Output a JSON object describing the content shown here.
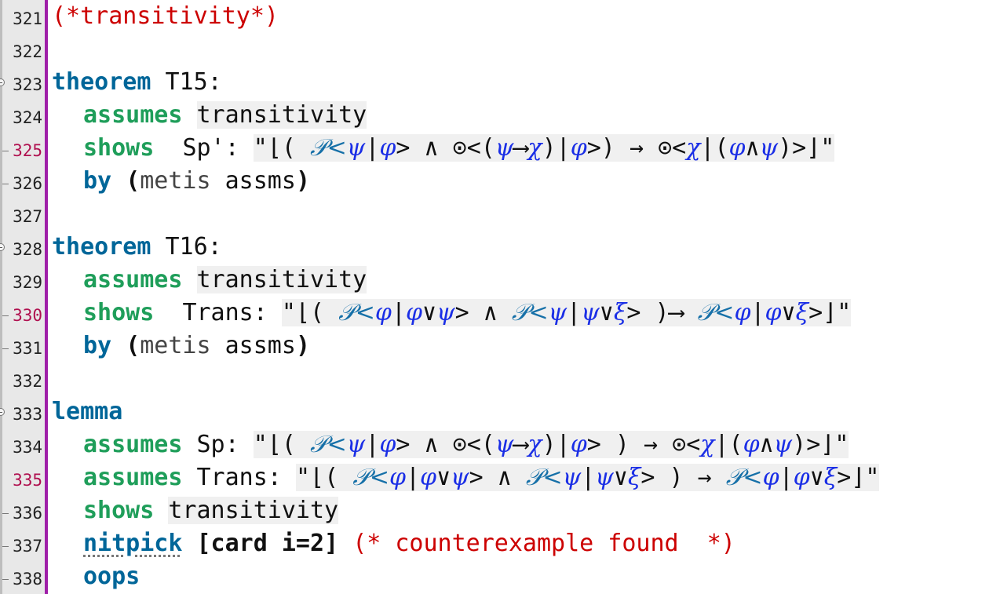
{
  "lines": [
    {
      "no": "321",
      "comment": "(*transitivity*)"
    },
    {
      "no": "322"
    },
    {
      "no": "323",
      "kw": "theorem",
      "name": "T15:"
    },
    {
      "no": "324",
      "kw": "assumes",
      "rest": "transitivity"
    },
    {
      "no": "325",
      "kw": "shows",
      "label": "Sp':"
    },
    {
      "no": "326",
      "kw": "by",
      "open": "(",
      "method": "metis",
      "args": " assms",
      "close": ")"
    },
    {
      "no": "327"
    },
    {
      "no": "328",
      "kw": "theorem",
      "name": "T16:"
    },
    {
      "no": "329",
      "kw": "assumes",
      "rest": "transitivity"
    },
    {
      "no": "330",
      "kw": "shows",
      "label": "Trans:"
    },
    {
      "no": "331",
      "kw": "by",
      "open": "(",
      "method": "metis",
      "args": " assms",
      "close": ")"
    },
    {
      "no": "332"
    },
    {
      "no": "333",
      "kw": "lemma"
    },
    {
      "no": "334",
      "kw": "assumes",
      "label": "Sp:"
    },
    {
      "no": "335",
      "kw": "assumes",
      "label": "Trans:"
    },
    {
      "no": "336",
      "kw": "shows",
      "rest": "transitivity"
    },
    {
      "no": "337",
      "kw": "nitpick",
      "args": "[card i=2]",
      "comment": "(* counterexample found  *)"
    },
    {
      "no": "338",
      "kw": "oops"
    }
  ],
  "symbols": {
    "P": "𝒫",
    "phi": "φ",
    "psi": "ψ",
    "chi": "χ",
    "xi": "ξ",
    "odot": "⊙",
    "and": "∧",
    "or": "∨",
    "imp": "⟶",
    "to": "→",
    "lfloor": "⌊",
    "rfloor": "⌋",
    "quote": "\""
  },
  "colors": {
    "keyword_blue": "#006699",
    "keyword_green": "#1f9e5a",
    "comment_red": "#cc0000",
    "symbol_blue": "#1a2ee6",
    "gutter_bar": "#9f1fa8"
  }
}
